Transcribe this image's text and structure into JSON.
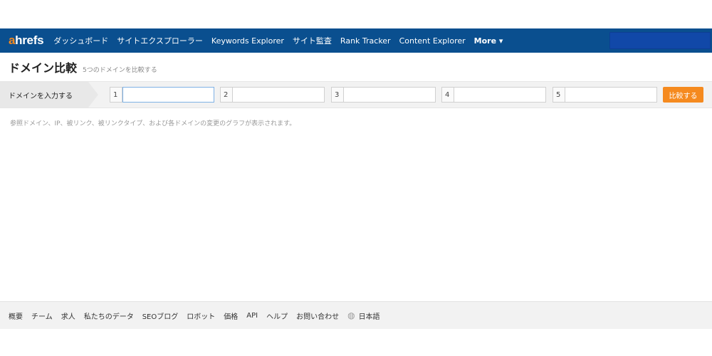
{
  "nav": {
    "logo_a": "a",
    "logo_rest": "hrefs",
    "items": [
      "ダッシュボード",
      "サイトエクスプローラー",
      "Keywords Explorer",
      "サイト監査",
      "Rank Tracker",
      "Content Explorer"
    ],
    "more": "More ▾"
  },
  "page": {
    "title": "ドメイン比較",
    "subtitle": "5つのドメインを比較する"
  },
  "inputbar": {
    "label": "ドメインを入力する",
    "domains": [
      {
        "num": "1",
        "value": ""
      },
      {
        "num": "2",
        "value": ""
      },
      {
        "num": "3",
        "value": ""
      },
      {
        "num": "4",
        "value": ""
      },
      {
        "num": "5",
        "value": ""
      }
    ],
    "compare": "比較する"
  },
  "description": "参照ドメイン、IP、被リンク、被リンクタイプ、および各ドメインの変更のグラフが表示されます。",
  "footer": {
    "items": [
      "概要",
      "チーム",
      "求人",
      "私たちのデータ",
      "SEOブログ",
      "ロボット",
      "価格",
      "API",
      "ヘルプ",
      "お問い合わせ"
    ],
    "language": "日本語"
  },
  "colors": {
    "nav_bg": "#0a4f8f",
    "accent": "#f58a1f"
  }
}
